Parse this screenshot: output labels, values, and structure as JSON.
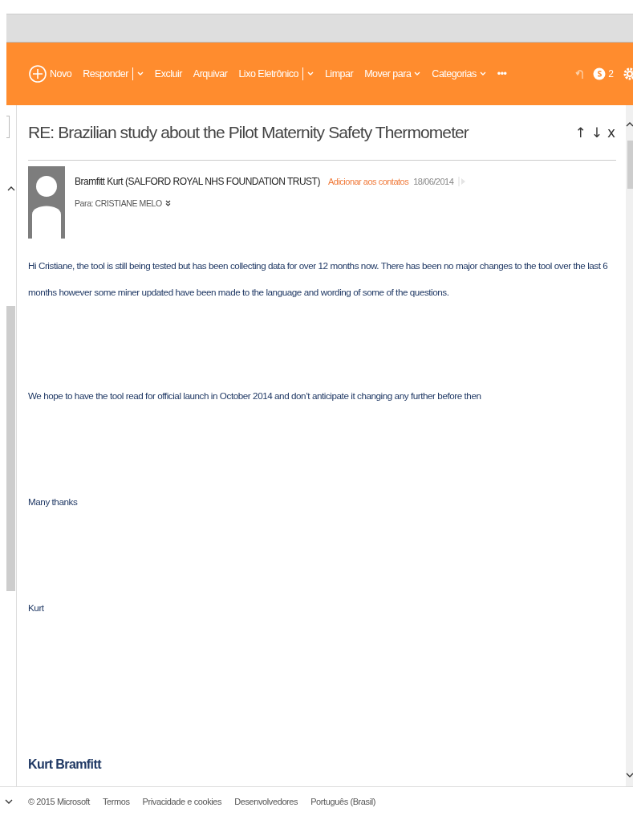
{
  "toolbar": {
    "items": [
      {
        "label": "Novo",
        "kind": "new"
      },
      {
        "label": "Responder",
        "kind": "split"
      },
      {
        "label": "Excluir",
        "kind": "plain"
      },
      {
        "label": "Arquivar",
        "kind": "plain"
      },
      {
        "label": "Lixo Eletrônico",
        "kind": "split"
      },
      {
        "label": "Limpar",
        "kind": "plain"
      },
      {
        "label": "Mover para",
        "kind": "menu"
      },
      {
        "label": "Categorias",
        "kind": "menu"
      },
      {
        "label": "•••",
        "kind": "plain"
      }
    ],
    "skype_count": "2"
  },
  "message": {
    "subject": "RE: Brazilian study about the Pilot Maternity Safety Thermometer",
    "nav": [
      "↑",
      "↓",
      "x"
    ],
    "sender": "Bramfitt Kurt (SALFORD ROYAL NHS FOUNDATION TRUST)",
    "add_contact": "Adicionar aos contatos",
    "date": "18/06/2014",
    "to": "Para: CRISTIANE MELO",
    "body": [
      {
        "text": "Hi Cristiane,  the tool is still being tested but has been collecting data for over 12 months now.  There has been no major changes to the tool over the last 6 months however some miner updated have been made to the language and wording of some of the questions."
      },
      {
        "text": "We hope to have the tool read for official launch in October 2014 and don’t anticipate it changing any further before then"
      },
      {
        "text": "Many thanks"
      },
      {
        "text": "Kurt"
      }
    ],
    "signature": "Kurt Bramfitt"
  },
  "footer": [
    "© 2015 Microsoft",
    "Termos",
    "Privacidade e cookies",
    "Desenvolvedores",
    "Português (Brasil)"
  ]
}
